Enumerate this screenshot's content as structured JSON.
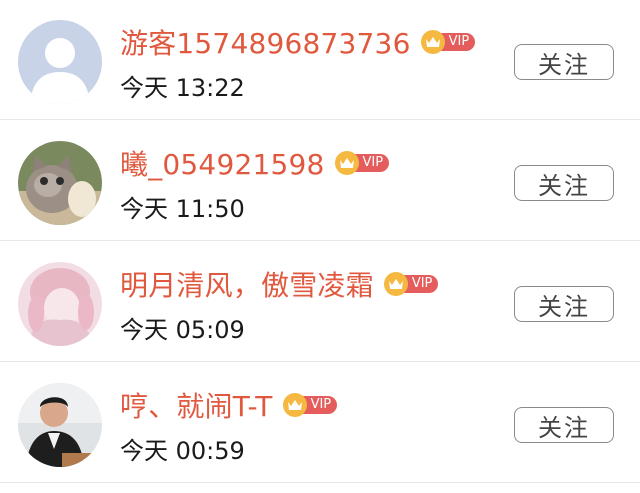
{
  "followers": [
    {
      "name": "游客1574896873736",
      "vip_label": "VIP",
      "time": "今天 13:22",
      "follow_label": "关注",
      "avatar": "default-user-avatar"
    },
    {
      "name": "曦_054921598",
      "vip_label": "VIP",
      "time": "今天 11:50",
      "follow_label": "关注",
      "avatar": "kitten-photo-avatar"
    },
    {
      "name": "明月清风，傲雪凌霜",
      "vip_label": "VIP",
      "time": "今天 05:09",
      "follow_label": "关注",
      "avatar": "anime-girl-avatar"
    },
    {
      "name": "哼、就闹T-T",
      "vip_label": "VIP",
      "time": "今天 00:59",
      "follow_label": "关注",
      "avatar": "person-photo-avatar"
    }
  ],
  "colors": {
    "name": "#e0593f",
    "vip_tag": "#e45c5c",
    "vip_crown": "#f5b942",
    "button_border": "#8a8a8a"
  }
}
